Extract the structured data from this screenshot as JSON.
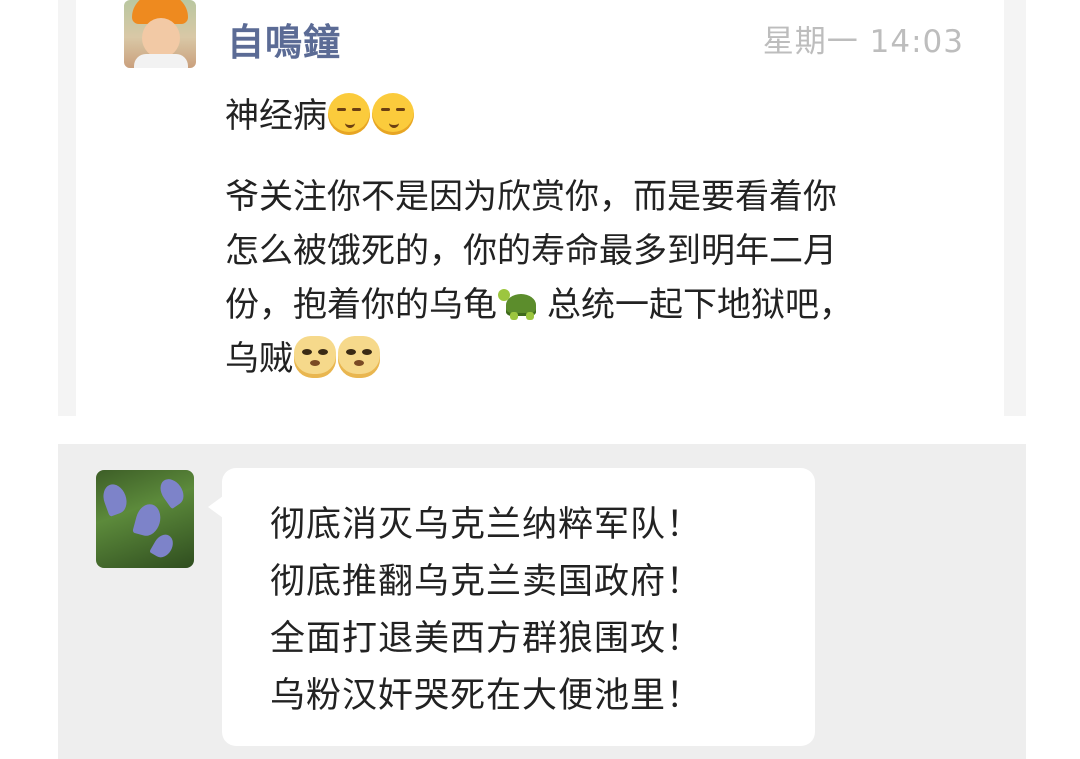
{
  "comment": {
    "author": "自鳴鐘",
    "time": "星期一 14:03",
    "message_1": "神经病",
    "message_2": [
      "爷关注你不是因为欣赏你，而是要看着你",
      "怎么被饿死的，你的寿命最多到明年二月",
      "份，抱着你的乌龟",
      "总统一起下地狱吧，",
      "乌贼"
    ]
  },
  "chat": {
    "lines": [
      "彻底消灭乌克兰纳粹军队！",
      "彻底推翻乌克兰卖国政府！",
      "全面打退美西方群狼围攻！",
      "乌粉汉奸哭死在大便池里！"
    ]
  },
  "icons": [
    "smirk-face-emoji",
    "turtle-emoji",
    "doge-emoji"
  ],
  "colors": {
    "author_name": "#5b6b95",
    "timestamp": "#bdbdbd",
    "chat_background": "#eeeeee",
    "bubble": "#ffffff"
  }
}
